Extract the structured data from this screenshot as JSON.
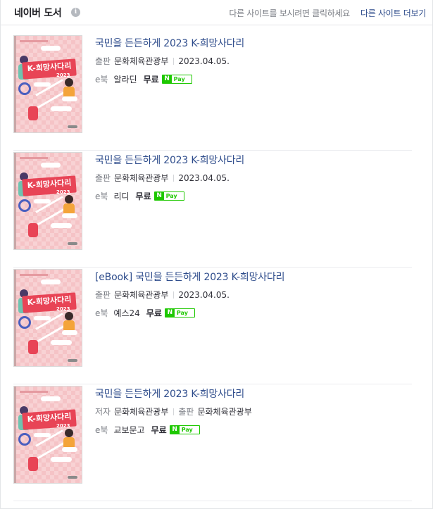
{
  "header": {
    "title": "네이버 도서",
    "info_icon": "i",
    "hint": "다른 사이트를 보시려면 클릭하세요",
    "more_link": "다른 사이트 더보기"
  },
  "books": [
    {
      "title": "국민을 든든하게 2023 K-희망사다리",
      "meta": [
        {
          "key": "출판",
          "value": "문화체육관광부"
        },
        {
          "key": "",
          "value": "2023.04.05."
        }
      ],
      "buy_label": "e북",
      "store": "알라딘",
      "price": "무료",
      "pay_n": "N",
      "pay_label": "Pay"
    },
    {
      "title": "국민을 든든하게 2023 K-희망사다리",
      "meta": [
        {
          "key": "출판",
          "value": "문화체육관광부"
        },
        {
          "key": "",
          "value": "2023.04.05."
        }
      ],
      "buy_label": "e북",
      "store": "리디",
      "price": "무료",
      "pay_n": "N",
      "pay_label": "Pay"
    },
    {
      "title": "[eBook] 국민을 든든하게 2023 K-희망사다리",
      "meta": [
        {
          "key": "출판",
          "value": "문화체육관광부"
        },
        {
          "key": "",
          "value": "2023.04.05."
        }
      ],
      "buy_label": "e북",
      "store": "예스24",
      "price": "무료",
      "pay_n": "N",
      "pay_label": "Pay"
    },
    {
      "title": "국민을 든든하게 2023 K-희망사다리",
      "meta": [
        {
          "key": "저자",
          "value": "문화체육관광부"
        },
        {
          "key": "출판",
          "value": "문화체육관광부"
        }
      ],
      "buy_label": "e북",
      "store": "교보문고",
      "price": "무료",
      "pay_n": "N",
      "pay_label": "Pay"
    }
  ],
  "cover": {
    "banner_text": "K-희망사다리",
    "year": "2023"
  },
  "colors": {
    "link": "#2f4d8c",
    "npay_green": "#1ec800",
    "cover_red": "#e84456"
  }
}
